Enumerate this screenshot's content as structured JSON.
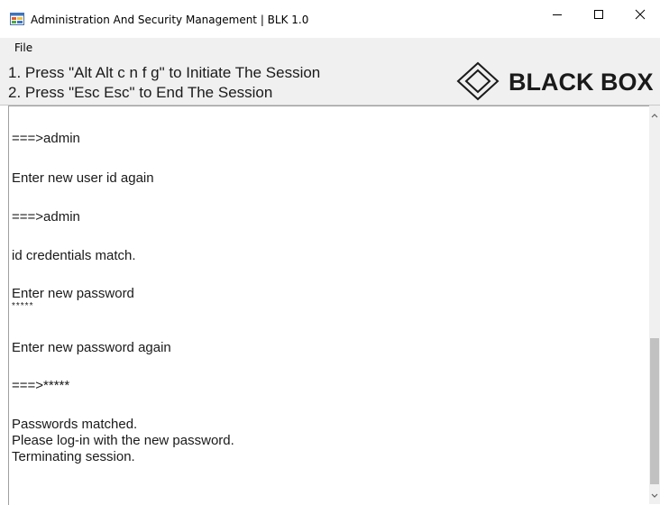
{
  "window": {
    "title": "Administration And Security Management  |  BLK 1.0"
  },
  "menu": {
    "file_label": "File"
  },
  "header": {
    "instruction_1": "1. Press \"Alt Alt c n f g\" to Initiate The Session",
    "instruction_2": "2. Press \"Esc Esc\" to End The Session",
    "logo_text": "BLACK BOX"
  },
  "console": {
    "lines": [
      "===>admin",
      "Enter new user id again",
      "===>admin",
      "id credentials match.",
      "Enter new password",
      "*****",
      "Enter new password again",
      "===>*****",
      "Passwords matched.",
      "Please log-in with the new password.",
      "Terminating session."
    ]
  },
  "icons": {
    "app": "app-window-icon",
    "minimize": "minimize-icon",
    "maximize": "maximize-icon",
    "close": "close-icon",
    "logo": "black-box-diamond-logo",
    "scroll_up": "chevron-up-icon",
    "scroll_down": "chevron-down-icon"
  },
  "colors": {
    "chrome_background": "#f0f0f0",
    "console_background": "#ffffff",
    "text": "#1a1a1a"
  }
}
